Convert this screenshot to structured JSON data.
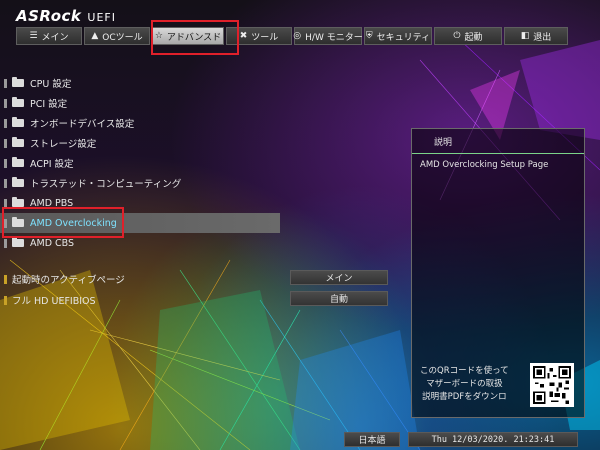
{
  "brand": {
    "logo": "ASRock",
    "suffix": "UEFI"
  },
  "tabs": [
    {
      "label": "メイン",
      "icon": "list-icon"
    },
    {
      "label": "OCツール",
      "icon": "flame-icon"
    },
    {
      "label": "アドバンスド",
      "icon": "star-icon",
      "active": true
    },
    {
      "label": "ツール",
      "icon": "tools-icon"
    },
    {
      "label": "H/W モニター",
      "icon": "monitor-icon"
    },
    {
      "label": "セキュリティ",
      "icon": "shield-icon"
    },
    {
      "label": "起動",
      "icon": "power-icon"
    },
    {
      "label": "退出",
      "icon": "exit-icon"
    }
  ],
  "menu": {
    "items": [
      {
        "label": "CPU 設定"
      },
      {
        "label": "PCI 設定"
      },
      {
        "label": "オンボードデバイス設定"
      },
      {
        "label": "ストレージ設定"
      },
      {
        "label": "ACPI 設定"
      },
      {
        "label": "トラステッド・コンピューティング"
      },
      {
        "label": "AMD PBS"
      },
      {
        "label": "AMD Overclocking",
        "selected": true
      },
      {
        "label": "AMD CBS"
      }
    ]
  },
  "options": [
    {
      "label": "起動時のアクティブページ",
      "value": "メイン"
    },
    {
      "label": "フル HD UEFIBIOS",
      "value": "自動"
    }
  ],
  "help": {
    "title": "説明",
    "description": "AMD Overclocking Setup Page",
    "qr_line1": "このQRコードを使って",
    "qr_line2": "マザーボードの取扱",
    "qr_line3": "説明書PDFをダウンロ"
  },
  "footer": {
    "language": "日本語",
    "datetime": "Thu 12/03/2020. 21:23:41"
  },
  "colors": {
    "highlight": "#e0202a",
    "selected_text": "#7fe3ff"
  }
}
